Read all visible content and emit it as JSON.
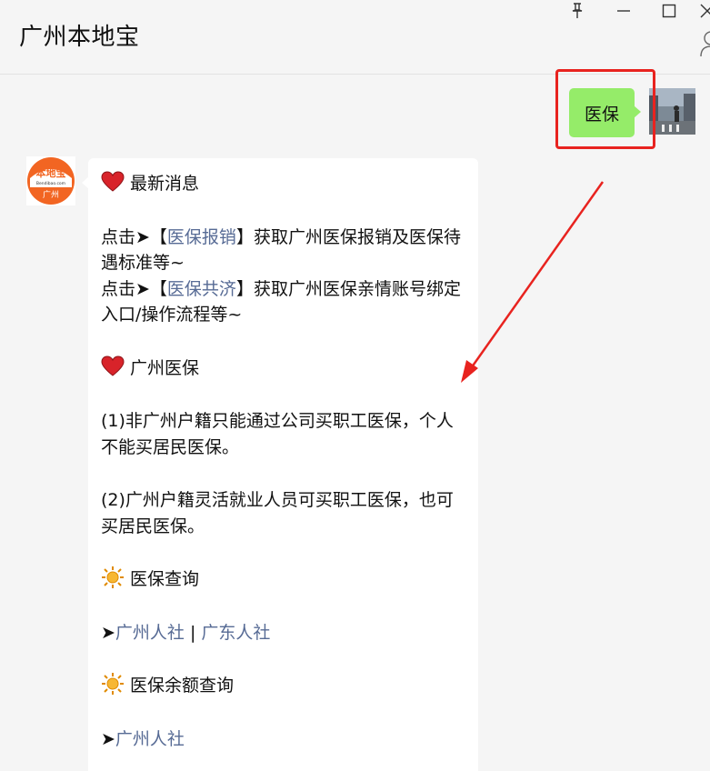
{
  "window": {
    "title": "广州本地宝"
  },
  "sent_message": {
    "text": "医保"
  },
  "bot": {
    "logo_text": "本地宝",
    "logo_sub": "Bendibao.com",
    "logo_city": "广州"
  },
  "received_message": {
    "section1_heading": "最新消息",
    "line1_prefix": "点击➤【",
    "line1_link": "医保报销",
    "line1_suffix": "】获取广州医保报销及医保待遇标准等~",
    "line2_prefix": "点击➤【",
    "line2_link": "医保共济",
    "line2_suffix": "】获取广州医保亲情账号绑定入口/操作流程等~",
    "section2_heading": "广州医保",
    "para1": "(1)非广州户籍只能通过公司买职工医保，个人不能买居民医保。",
    "para2": "(2)广州户籍灵活就业人员可买职工医保，也可买居民医保。",
    "section3_heading": "医保查询",
    "query_arrow": "➤",
    "query_link1": "广州人社",
    "query_sep": " | ",
    "query_link2": "广东人社",
    "section4_heading": "医保余额查询",
    "balance_arrow": "➤",
    "balance_link": "广州人社"
  },
  "colors": {
    "sent_bubble": "#95ec69",
    "link": "#576b95",
    "highlight": "#e8231f",
    "logo_orange": "#f26522"
  },
  "icons": {
    "heart": "heart-icon",
    "sun": "sun-icon",
    "pin": "pin-icon",
    "minimize": "minimize-icon",
    "maximize": "maximize-icon",
    "close": "close-icon"
  }
}
